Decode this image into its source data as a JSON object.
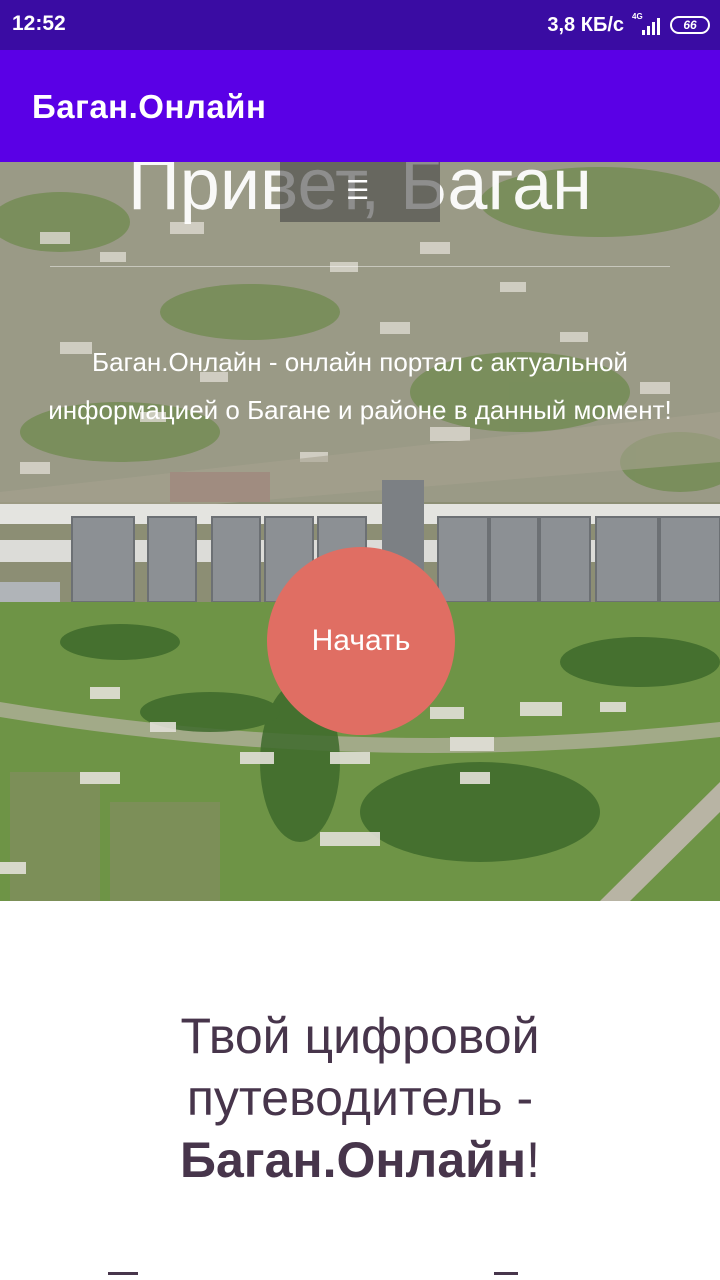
{
  "status_bar": {
    "time": "12:52",
    "speed": "3,8 КБ/с",
    "network": "4G",
    "battery": "66"
  },
  "app_bar": {
    "title": "Баган.Онлайн"
  },
  "hero": {
    "heading": "Привет, Баган",
    "description": "Баган.Онлайн - онлайн портал с актуальной информацией о Багане и районе в данный момент!",
    "button_label": "Начать",
    "menu_icon": "menu-icon"
  },
  "section": {
    "title_line1": "Твой цифровой",
    "title_line2": "путеводитель -",
    "title_bold": "Баган.Онлайн",
    "title_end": "!"
  },
  "colors": {
    "status_bar": "#3a0ca3",
    "app_bar": "#5a00e6",
    "button": "#e06e63",
    "heading_text": "#47354b"
  }
}
